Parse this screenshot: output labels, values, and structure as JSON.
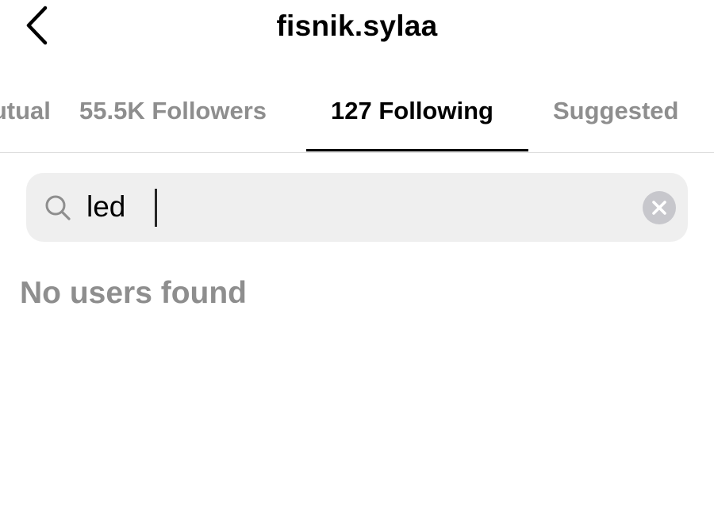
{
  "header": {
    "title": "fisnik.sylaa",
    "back_icon": "chevron-left-icon"
  },
  "tabs": [
    {
      "label": "Mutual",
      "visible_text": "ual",
      "active": false
    },
    {
      "label": "55.5K Followers",
      "active": false
    },
    {
      "label": "127 Following",
      "active": true
    },
    {
      "label": "Suggested",
      "active": false
    }
  ],
  "search": {
    "value": "led",
    "icon": "search-icon",
    "clear_icon": "clear-icon"
  },
  "results": {
    "empty_message": "No users found"
  },
  "colors": {
    "text_primary": "#000000",
    "text_secondary": "#8e8e8e",
    "search_background": "#efefef",
    "divider": "#dbdbdb",
    "clear_button": "#c7c7cc"
  }
}
